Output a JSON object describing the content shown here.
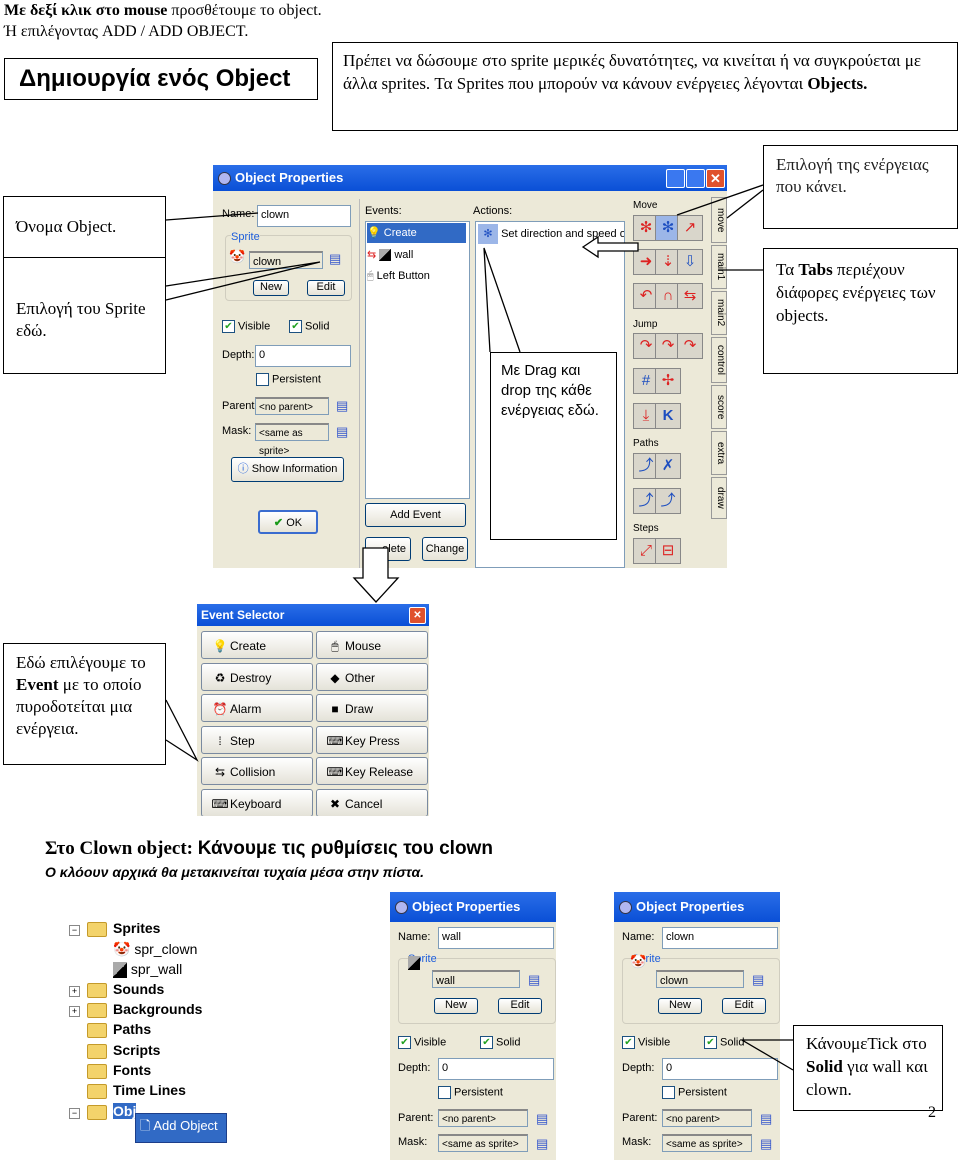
{
  "intro": {
    "line1_bold": "Με δεξί κλικ στο mouse",
    "line1_rest": " προσθέτουμε το object.",
    "line2": "Ή επιλέγοντας ADD / ADD OBJECT."
  },
  "heading_box": "Δημιουργία ενός Object",
  "top_note": {
    "text": "Πρέπει να δώσουμε στο sprite μερικές δυνατότητες, να κινείται ή να συγκρούεται με άλλα sprites. Τα Sprites που μπορούν να κάνουν ενέργειες λέγονται ",
    "bold": "Objects."
  },
  "callouts": {
    "name": "Όνομα Object.",
    "sprite": "Επιλογή του Sprite εδώ.",
    "action_choice": "Επιλογή της ενέργειας που κάνει.",
    "tabs_pre": "Τα ",
    "tabs_bold": "Tabs",
    "tabs_post": " περιέχουν διάφορες ενέργειες των objects.",
    "drag": "Με Drag και drop της κάθε ενέργειας εδώ.",
    "event_pre": "Εδώ επιλέγουμε το ",
    "event_bold": "Event",
    "event_post": " με το οποίο πυροδοτείται μια ενέργεια.",
    "solid_pre": "ΚάνουμεTick στο ",
    "solid_bold": "Solid",
    "solid_post": " για wall και clown."
  },
  "main_window": {
    "title": "Object Properties",
    "name_label": "Name:",
    "name_value": "clown",
    "sprite_group": "Sprite",
    "sprite_value": "clown",
    "new": "New",
    "edit": "Edit",
    "visible": "Visible",
    "solid": "Solid",
    "depth_label": "Depth:",
    "depth_value": "0",
    "persistent": "Persistent",
    "parent_label": "Parent:",
    "parent_value": "<no parent>",
    "mask_label": "Mask:",
    "mask_value": "<same as sprite>",
    "show_info": "Show Information",
    "ok": "OK",
    "events_label": "Events:",
    "events": [
      "Create",
      "wall",
      "Left Button"
    ],
    "actions_label": "Actions:",
    "action_item": "Set direction and speed of mol",
    "add_event": "Add Event",
    "delete": "elete",
    "change": "Change",
    "palette_groups": [
      "Move",
      "Jump",
      "Paths",
      "Steps"
    ],
    "tabs": [
      "move",
      "main1",
      "main2",
      "control",
      "score",
      "extra",
      "draw"
    ]
  },
  "event_selector": {
    "title": "Event Selector",
    "buttons": [
      {
        "label": "Create",
        "icon": "lightbulb-icon",
        "glyph": "💡"
      },
      {
        "label": "Mouse",
        "icon": "mouse-icon",
        "glyph": "🖱"
      },
      {
        "label": "Destroy",
        "icon": "trash-icon",
        "glyph": "♻"
      },
      {
        "label": "Other",
        "icon": "diamond-icon",
        "glyph": "◆"
      },
      {
        "label": "Alarm",
        "icon": "clock-icon",
        "glyph": "⏰"
      },
      {
        "label": "Draw",
        "icon": "shapes-icon",
        "glyph": "■"
      },
      {
        "label": "Step",
        "icon": "footsteps-icon",
        "glyph": "⁞"
      },
      {
        "label": "Key Press",
        "icon": "key-press-icon",
        "glyph": "⌨"
      },
      {
        "label": "Collision",
        "icon": "collision-icon",
        "glyph": "⇆"
      },
      {
        "label": "Key Release",
        "icon": "key-release-icon",
        "glyph": "⌨"
      },
      {
        "label": "Keyboard",
        "icon": "keyboard-icon",
        "glyph": "⌨"
      },
      {
        "label": "Cancel",
        "icon": "cancel-icon",
        "glyph": "✖"
      }
    ]
  },
  "section": {
    "line1_serif": "Στο Clown object: ",
    "line1_sans": "Κάνουμε τις ρυθμίσεις του clown",
    "line2": "Ο κλόουν αρχικά θα μετακινείται τυχαία μέσα στην πίστα."
  },
  "tree": {
    "items": [
      "Sprites",
      "spr_clown",
      "spr_wall",
      "Sounds",
      "Backgrounds",
      "Paths",
      "Scripts",
      "Fonts",
      "Time Lines",
      "Obj"
    ],
    "context_menu": "Add Object"
  },
  "small_windows": [
    {
      "title": "Object Properties",
      "name_label": "Name:",
      "name": "wall",
      "sprite_group": "Sprite",
      "sprite": "wall",
      "new": "New",
      "edit": "Edit",
      "visible": "Visible",
      "solid": "Solid",
      "depth_label": "Depth:",
      "depth": "0",
      "persistent": "Persistent",
      "parent_label": "Parent:",
      "parent": "<no parent>",
      "mask_label": "Mask:",
      "mask": "<same as sprite>"
    },
    {
      "title": "Object Properties",
      "name_label": "Name:",
      "name": "clown",
      "sprite_group": "Sprite",
      "sprite": "clown",
      "new": "New",
      "edit": "Edit",
      "visible": "Visible",
      "solid": "Solid",
      "depth_label": "Depth:",
      "depth": "0",
      "persistent": "Persistent",
      "parent_label": "Parent:",
      "parent": "<no parent>",
      "mask_label": "Mask:",
      "mask": "<same as sprite>"
    }
  ],
  "page_number": "2",
  "colors": {
    "titlebar": "#0a4fd6",
    "window_bg": "#ece9d8",
    "selection": "#316ac5"
  }
}
